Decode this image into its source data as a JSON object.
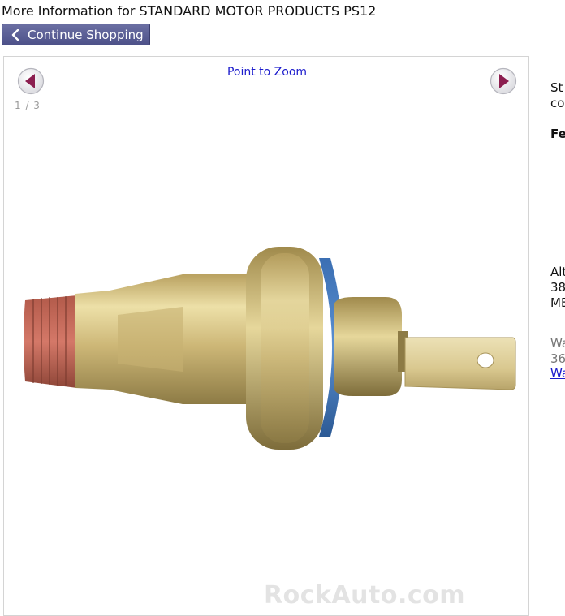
{
  "header": {
    "title": "More Information for STANDARD MOTOR PRODUCTS PS12",
    "continue_label": "Continue Shopping"
  },
  "viewer": {
    "zoom_label": "Point to Zoom",
    "counter": "1 / 3",
    "watermark": "RockAuto.com"
  },
  "side_panel": {
    "line1": "St",
    "line2": "co",
    "features_heading": "Fe",
    "alt_line1": "Alt",
    "alt_line2": "38",
    "alt_line3": "MB",
    "warranty_line1": "Wa",
    "warranty_line2": "36",
    "warranty_link": "Wa"
  },
  "colors": {
    "button_bg": "#5b5f98",
    "link": "#1a1acc",
    "arrow": "#8b1e4f"
  }
}
